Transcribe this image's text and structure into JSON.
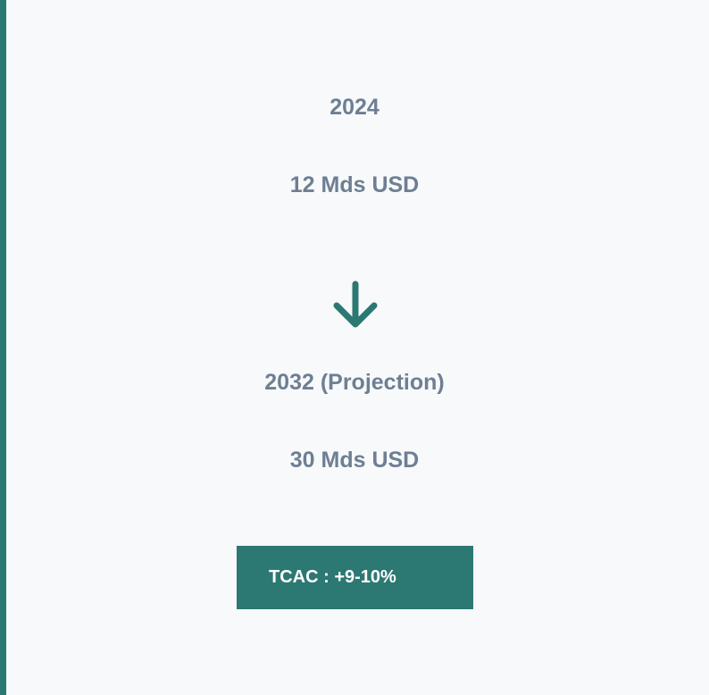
{
  "diagram": {
    "start": {
      "year": "2024",
      "value": "12 Mds USD"
    },
    "end": {
      "year": "2032 (Projection)",
      "value": "30 Mds USD"
    },
    "arrow_icon": "arrow-down-icon",
    "badge": {
      "label": "TCAC : +9-10%"
    }
  },
  "colors": {
    "accent": "#2c7873",
    "text": "#6e7f93",
    "background": "#f7f9fb",
    "badge_text": "#ffffff"
  }
}
